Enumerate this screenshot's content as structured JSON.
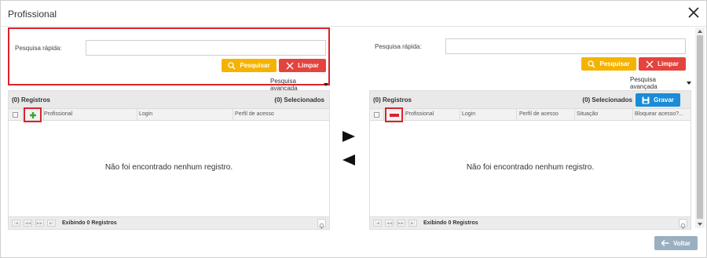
{
  "window": {
    "title": "Profissional"
  },
  "left_panel": {
    "search_label": "Pesquisa rápida:",
    "search_value": "",
    "search_button": "Pesquisar",
    "clear_button": "Limpar",
    "advanced_search": "Pesquisa avançada",
    "records_count": "(0) Registros",
    "selected_count": "(0) Selecionados",
    "columns": [
      "Profissional",
      "Login",
      "Perfil de acesso"
    ],
    "empty_message": "Não foi encontrado nenhum registro.",
    "footer_text": "Exibindo 0 Registros"
  },
  "right_panel": {
    "search_label": "Pesquisa rápida:",
    "search_value": "",
    "search_button": "Pesquisar",
    "clear_button": "Limpar",
    "advanced_search": "Pesquisa avançada",
    "records_count": "(0) Registros",
    "selected_count": "(0) Selecionados",
    "save_button": "Gravar",
    "columns": [
      "Profissional",
      "Login",
      "Perfil de acesso",
      "Situação",
      "Bloquear acesso?..."
    ],
    "empty_message": "Não foi encontrado nenhum registro.",
    "footer_text": "Exibindo 0 Registros"
  },
  "footer": {
    "back_button": "Voltar"
  },
  "colors": {
    "highlight_border": "#d9242b",
    "search_button": "#f5b300",
    "clear_button": "#e3443d",
    "save_button": "#1a8cd8",
    "back_button": "#9ab0c1",
    "add_icon": "#3aa435",
    "remove_icon": "#d9242b"
  },
  "icons": {
    "close": "close-icon",
    "search": "search-icon",
    "clear": "x-icon",
    "save": "floppy-icon",
    "add": "plus-icon",
    "remove": "minus-icon",
    "move_right": "arrow-right-icon",
    "move_left": "arrow-left-icon",
    "back": "arrow-back-icon",
    "hint": "lightbulb-icon"
  }
}
